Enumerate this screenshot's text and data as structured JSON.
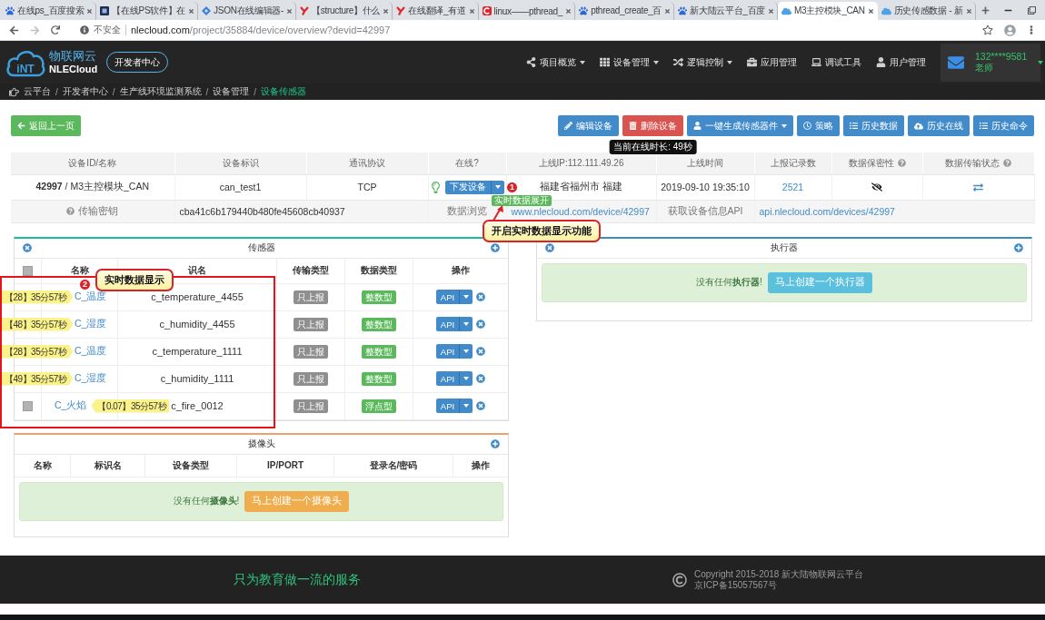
{
  "browser": {
    "tabs": [
      {
        "title": "在线ps_百度搜索",
        "selected": false
      },
      {
        "title": "【在线PS软件】在",
        "selected": false
      },
      {
        "title": "JSON在线编辑器-",
        "selected": false
      },
      {
        "title": "【structure】什么",
        "selected": false
      },
      {
        "title": "在线翻译_有道",
        "selected": false
      },
      {
        "title": "linux——pthread_",
        "selected": false
      },
      {
        "title": "pthread_create_百",
        "selected": false
      },
      {
        "title": "新大陆云平台_百度",
        "selected": false
      },
      {
        "title": "M3主控模块_CAN",
        "selected": true
      },
      {
        "title": "历史传感数据 - 新",
        "selected": false
      }
    ],
    "address": {
      "security": "不安全",
      "host": "nlecloud.com",
      "path": "/project/35884/device/overview?devid=42997"
    }
  },
  "header": {
    "logo_mark": "iNT",
    "brand_cn": "物联网云",
    "brand_en": "NLECloud",
    "dev_center": "开发者中心",
    "nav": [
      {
        "label": "项目概览",
        "dropdown": true
      },
      {
        "label": "设备管理",
        "dropdown": true
      },
      {
        "label": "逻辑控制",
        "dropdown": true
      },
      {
        "label": "应用管理",
        "dropdown": false
      },
      {
        "label": "调试工具",
        "dropdown": false
      },
      {
        "label": "用户管理",
        "dropdown": false
      }
    ],
    "user": {
      "phone": "132****9581",
      "role": "老师"
    }
  },
  "breadcrumb": {
    "items": [
      {
        "label": "云平台",
        "separator": "/",
        "current": false
      },
      {
        "label": "开发者中心",
        "separator": "/",
        "current": false
      },
      {
        "label": "生产线环境监测系统",
        "separator": "/",
        "current": false
      },
      {
        "label": "设备管理",
        "separator": "/",
        "current": false
      },
      {
        "label": "设备传感器",
        "current": true
      }
    ]
  },
  "toolbar": {
    "back": "返回上一页",
    "actions": [
      {
        "label": "编辑设备",
        "kind": "primary",
        "dropdown": false
      },
      {
        "label": "删除设备",
        "kind": "danger",
        "dropdown": false,
        "tooltip": "当前在线时长: 49秒"
      },
      {
        "label": "一键生成传感器件",
        "kind": "primary",
        "dropdown": true
      },
      {
        "label": "策略",
        "kind": "primary",
        "dropdown": false
      },
      {
        "label": "历史数据",
        "kind": "primary",
        "dropdown": false
      },
      {
        "label": "历史在线",
        "kind": "primary",
        "dropdown": false
      },
      {
        "label": "历史命令",
        "kind": "primary",
        "dropdown": false
      }
    ]
  },
  "device": {
    "columns": [
      {
        "label": "设备ID/名称",
        "help": false
      },
      {
        "label": "设备标识",
        "help": false
      },
      {
        "label": "通讯协议",
        "help": false
      },
      {
        "label": "在线?",
        "help": false
      },
      {
        "label": "上线IP:112.111.49.26",
        "help": false
      },
      {
        "label": "上线时间",
        "help": false
      },
      {
        "label": "上报记录数",
        "help": false
      },
      {
        "label": "数据保密性",
        "help": true
      },
      {
        "label": "数据传输状态",
        "help": true
      }
    ],
    "row": {
      "id_name": "**42997** / M3主控模块_CAN",
      "identifier": "can_test1",
      "protocol": "TCP",
      "online": true,
      "send_button": "下发设备",
      "send_tooltip": "实时数据展开",
      "location": "福建省福州市 福建",
      "online_time": "2019-09-10 19:35:10",
      "records": "2521",
      "private": true
    },
    "details": [
      {
        "label": "传输密钥",
        "help": true,
        "value": "cba41c6b179440b480fe45608cb40937",
        "link": false
      },
      {
        "label": "数据浏览",
        "help": false,
        "value": "www.nlecloud.com/device/42997",
        "link": true
      },
      {
        "label": "获取设备信息API",
        "help": false,
        "value": "api.nlecloud.com/devices/42997",
        "link": true
      }
    ]
  },
  "callouts": [
    {
      "number": "1",
      "text": "开启实时数据显示功能"
    },
    {
      "number": "2",
      "text": "实时数据显示"
    }
  ],
  "sensors": {
    "title": "传感器",
    "remove_icon": true,
    "select_all_checked": false,
    "columns": [
      "名称",
      "识名",
      "传输类型",
      "数据类型",
      "操作"
    ],
    "rows": [
      {
        "name": "C_温度",
        "identifier": "c_temperature_4455",
        "transfer": "只上报",
        "data_type": "整数型",
        "action": "API"
      },
      {
        "name": "C_湿度",
        "identifier": "c_humidity_4455",
        "transfer": "只上报",
        "data_type": "整数型",
        "action": "API"
      },
      {
        "name": "C_温度",
        "identifier": "c_temperature_1111",
        "transfer": "只上报",
        "data_type": "整数型",
        "action": "API"
      },
      {
        "name": "C_湿度",
        "identifier": "c_humidity_1111",
        "transfer": "只上报",
        "data_type": "整数型",
        "action": "API"
      },
      {
        "checked": false,
        "name": "C_火焰",
        "identifier": "c_fire_0012",
        "transfer": "只上报",
        "data_type": "浮点型",
        "action": "API"
      }
    ],
    "realtime_tags": [
      {
        "text": "【28】35分57秒",
        "before_name": true
      },
      {
        "text": "【48】35分57秒",
        "before_name": true
      },
      {
        "text": "【28】35分57秒",
        "before_name": true
      },
      {
        "text": "【49】35分57秒",
        "before_name": true
      },
      {
        "text": "【0.07】35分57秒",
        "before_name": false
      }
    ]
  },
  "actuators": {
    "title": "执行器",
    "remove_icon": true,
    "empty_message": "没有任何**执行器**!",
    "create_button": "马上创建一个执行器"
  },
  "cameras": {
    "title": "摄像头",
    "remove_icon": false,
    "columns": [
      "名称",
      "标识名",
      "设备类型",
      "IP/PORT",
      "登录名/密码",
      "操作"
    ],
    "empty_message": "没有任何**摄像头**!",
    "create_button": "马上创建一个摄像头"
  },
  "footer": {
    "slogan": "只为教育做一流的服务",
    "copyright": "Copyright 2015-2018 新大陆物联网云平台",
    "icp": "京ICP备15057567号"
  }
}
